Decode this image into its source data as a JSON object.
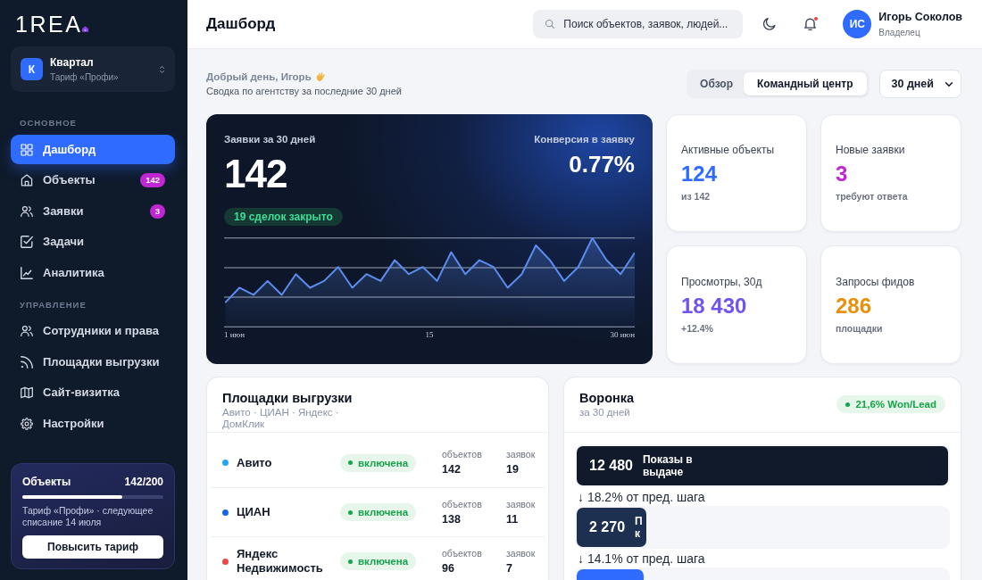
{
  "sidebar": {
    "logo": "1REA",
    "workspace": {
      "initial": "К",
      "name": "Квартал",
      "plan": "Тариф «Профи»"
    },
    "sections": [
      {
        "heading": "ОСНОВНОЕ",
        "items": [
          {
            "label": "Дашборд",
            "selected": true
          },
          {
            "label": "Объекты",
            "badge": "142",
            "selected": false
          },
          {
            "label": "Заявки",
            "badge": "3",
            "selected": false
          },
          {
            "label": "Задачи",
            "selected": false
          },
          {
            "label": "Аналитика",
            "selected": false
          }
        ]
      },
      {
        "heading": "УПРАВЛЕНИЕ",
        "items": [
          {
            "label": "Сотрудники и права",
            "selected": false
          },
          {
            "label": "Площадки выгрузки",
            "selected": false
          },
          {
            "label": "Сайт-визитка",
            "selected": false
          },
          {
            "label": "Настройки",
            "selected": false
          }
        ]
      }
    ],
    "plan_card": {
      "title": "Объекты",
      "count": "142/200",
      "level": 0.71,
      "note": "Тариф «Профи» · следующее списание 14 июля",
      "button": "Повысить тариф"
    }
  },
  "header": {
    "title": "Дашборд",
    "search": {
      "placeholder": "Поиск объектов, заявок, людей..."
    },
    "notifications": {
      "unread": true
    },
    "user": {
      "initials": "ИС",
      "name": "Игорь Соколов",
      "role": "Владелец"
    }
  },
  "greeting": {
    "title": "Добрый день, Игорь",
    "subtitle": "Сводка по агентству за последние 30 дней"
  },
  "view_tabs": [
    {
      "label": "Обзор",
      "selected": false
    },
    {
      "label": "Командный центр",
      "selected": true
    }
  ],
  "period": {
    "value": "30 дней"
  },
  "hero": {
    "title": "Заявки за 30 дней",
    "value": "142",
    "badge": "19 сделок закрыто",
    "conversion_label": "Конверсия в заявку",
    "conversion_value": "0.77%",
    "chart": {
      "x_labels": [
        "1 июн",
        "15",
        "30 июн"
      ]
    }
  },
  "kpis": [
    {
      "label": "Активные объекты",
      "value": "124",
      "note": "из 142",
      "color": "#2f6bff"
    },
    {
      "label": "Новые заявки",
      "value": "3",
      "note": "требуют ответа",
      "color": "#c026d3"
    },
    {
      "label": "Просмотры, 30д",
      "value": "18 430",
      "note": "+12.4%",
      "color": "#6d55f0"
    },
    {
      "label": "Запросы фидов",
      "value": "286",
      "note": "площадки",
      "color": "#e8900c"
    }
  ],
  "feeds": {
    "title": "Площадки выгрузки",
    "subtitle": "Авито · ЦИАН · Яндекс · ДомКлик",
    "rows": [
      {
        "name": "Авито",
        "color": "#1ea7f2",
        "status": "включена",
        "on": true,
        "objects_label": "объектов",
        "objects": "142",
        "leads_label": "заявок",
        "leads": "19"
      },
      {
        "name": "ЦИАН",
        "color": "#1565e8",
        "status": "включена",
        "on": true,
        "objects_label": "объектов",
        "objects": "138",
        "leads_label": "заявок",
        "leads": "11"
      },
      {
        "name": "Яндекс Недвижимость",
        "color": "#ef4444",
        "status": "включена",
        "on": true,
        "objects_label": "объектов",
        "objects": "96",
        "leads_label": "заявок",
        "leads": "7"
      }
    ]
  },
  "funnel": {
    "title": "Воронка",
    "subtitle": "за 30 дней",
    "badge": "21,6% Won/Lead",
    "steps": [
      {
        "value": "12 480",
        "label": "Показы в выдаче",
        "level": 1,
        "color": "#111a2b",
        "drop": "↓ 18.2% от пред. шага"
      },
      {
        "value": "2 270",
        "label": "П к",
        "level": 0.18,
        "color": "#1e3050",
        "drop": "↓ 14.1% от пред. шага"
      },
      {
        "level": 0.18,
        "color": "#2f6bff"
      }
    ]
  }
}
